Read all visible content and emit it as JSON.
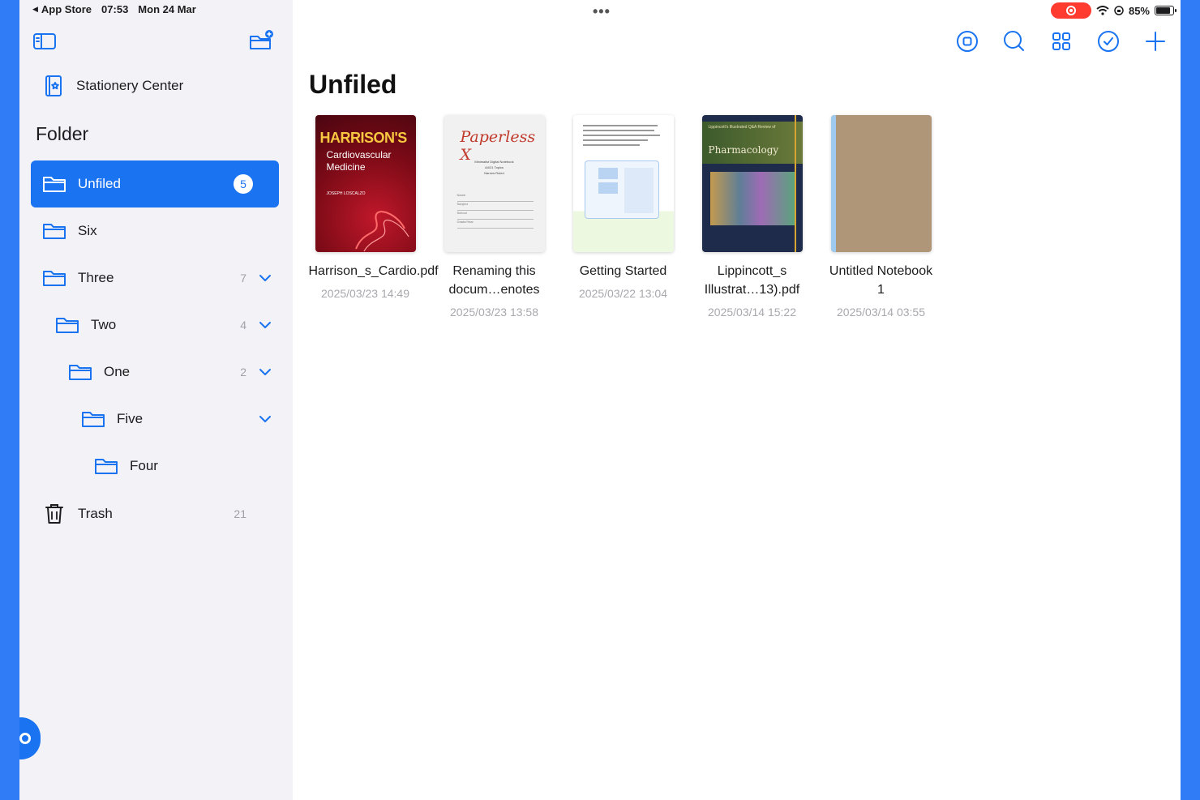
{
  "status_bar": {
    "back_app": "App Store",
    "time": "07:53",
    "date": "Mon 24 Mar",
    "battery": "85%"
  },
  "sidebar": {
    "stationery_label": "Stationery Center",
    "folder_heading": "Folder",
    "folders": [
      {
        "label": "Unfiled",
        "count": "5",
        "active": true
      },
      {
        "label": "Six",
        "count": ""
      },
      {
        "label": "Three",
        "count": "7"
      },
      {
        "label": "Two",
        "count": "4"
      },
      {
        "label": "One",
        "count": "2"
      },
      {
        "label": "Five",
        "count": ""
      },
      {
        "label": "Four",
        "count": ""
      }
    ],
    "trash": {
      "label": "Trash",
      "count": "21"
    }
  },
  "main": {
    "title": "Unfiled",
    "toolbar": [
      "record-icon",
      "search-icon",
      "grid-view-icon",
      "select-icon",
      "add-icon"
    ],
    "items": [
      {
        "name": "Harrison_s_Cardio.pdf",
        "date": "2025/03/23 14:49",
        "cover": {
          "title": "HARRISON'S",
          "subtitle_1": "Cardiovascular",
          "subtitle_2": "Medicine",
          "author": "JOSEPH LOSCALZO"
        }
      },
      {
        "name": "Renaming this docum…enotes",
        "date": "2025/03/23 13:58",
        "cover": {
          "title": "Paperless X",
          "line_1": "Minimalist Digital Notebook",
          "line_2": "A4/21 Topics",
          "line_3": "Narrow Ruled",
          "fields": [
            "Name",
            "Subject",
            "School",
            "Grade/Year"
          ]
        }
      },
      {
        "name": "Getting Started",
        "date": "2025/03/22 13:04",
        "cover": {}
      },
      {
        "name": "Lippincott_s Illustrat…13).pdf",
        "date": "2025/03/14 15:22",
        "cover": {
          "series": "Lippincott's Illustrated Q&A Review of",
          "title": "Pharmacology"
        }
      },
      {
        "name": "Untitled Notebook 1",
        "date": "2025/03/14 03:55",
        "cover": {}
      }
    ]
  },
  "colors": {
    "accent": "#1a73f0",
    "frame": "#2f7cf6",
    "sidebar_bg": "#f2f2f7",
    "record": "#ff3b30"
  }
}
